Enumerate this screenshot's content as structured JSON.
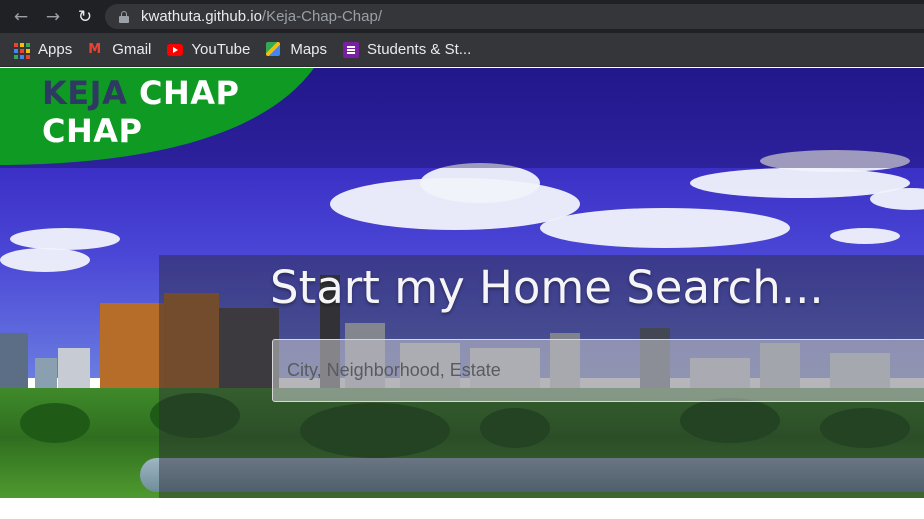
{
  "browser": {
    "nav": {
      "back_icon": "←",
      "forward_icon": "→",
      "reload_icon": "↻"
    },
    "address_bar": {
      "host": "kwathuta.github.io",
      "path": "/Keja-Chap-Chap/"
    },
    "bookmarks": [
      {
        "label": "Apps",
        "icon": "apps-grid-icon"
      },
      {
        "label": "Gmail",
        "icon": "gmail-icon"
      },
      {
        "label": "YouTube",
        "icon": "youtube-icon"
      },
      {
        "label": "Maps",
        "icon": "maps-icon"
      },
      {
        "label": "Students & St...",
        "icon": "classroom-icon"
      }
    ]
  },
  "page": {
    "logo": {
      "word1": "KEJA",
      "word2": "CHAP",
      "word3": "CHAP"
    },
    "search": {
      "title": "Start my Home Search...",
      "placeholder": "City, Neighborhood, Estate"
    },
    "colors": {
      "logo_green": "#0f9a24",
      "logo_dark_text": "#2f3a63",
      "sky_blue": "#3a2ec4"
    }
  }
}
